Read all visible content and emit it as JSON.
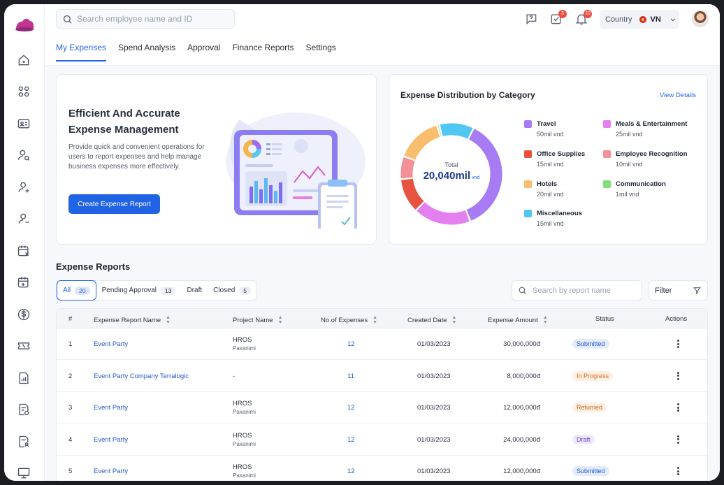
{
  "topbar": {
    "search_placeholder": "Search employee name and ID",
    "chat_badge": "",
    "tasks_badge": "3",
    "notifications_badge": "10",
    "country_label": "Country",
    "country_code": "VN"
  },
  "tabs": [
    {
      "label": "My Expenses",
      "active": true
    },
    {
      "label": "Spend Analysis",
      "active": false
    },
    {
      "label": "Approval",
      "active": false
    },
    {
      "label": "Finance Reports",
      "active": false
    },
    {
      "label": "Settings",
      "active": false
    }
  ],
  "promo": {
    "title": "Efficient And Accurate Expense Management",
    "description": "Provide quick and convenient operations for users to report expenses and help manage business expenses more effectively.",
    "button": "Create Expense Report"
  },
  "distribution": {
    "title": "Expense Distribution by Category",
    "view_details": "View Details",
    "total_label": "Total",
    "total_value": "20,040mil",
    "total_unit": "vnd",
    "categories": [
      {
        "name": "Travel",
        "value": "50mil vnd",
        "color": "#a77bf3"
      },
      {
        "name": "Meals & Entertainment",
        "value": "25mil vnd",
        "color": "#e47ff0"
      },
      {
        "name": "Office Supplies",
        "value": "15mil vnd",
        "color": "#e8533f"
      },
      {
        "name": "Employee Recognition",
        "value": "10mil vnd",
        "color": "#f38f96"
      },
      {
        "name": "Hotels",
        "value": "20mil vnd",
        "color": "#f8bd6d"
      },
      {
        "name": "Communication",
        "value": "1mil vnd",
        "color": "#7fe07b"
      },
      {
        "name": "Miscellaneous",
        "value": "15mil vnd",
        "color": "#4fc7f2"
      }
    ]
  },
  "reports": {
    "title": "Expense Reports",
    "filters": [
      {
        "label": "All",
        "count": "20",
        "active": true
      },
      {
        "label": "Pending Approval",
        "count": "13",
        "active": false
      },
      {
        "label": "Draft",
        "count": "",
        "active": false
      },
      {
        "label": "Closed",
        "count": "5",
        "active": false
      }
    ],
    "search_placeholder": "Search by report name",
    "filter_label": "Filter",
    "columns": [
      "#",
      "Expense Report Name",
      "Project Name",
      "No.of Expenses",
      "Created Date",
      "Expense Amount",
      "Status",
      "Actions"
    ],
    "rows": [
      {
        "no": "1",
        "name": "Event Party",
        "project": "HROS",
        "project_sub": "Paxanimi",
        "expenses": "12",
        "date": "01/03/2023",
        "amount": "30,000,000đ",
        "status": "Submitted"
      },
      {
        "no": "2",
        "name": "Event Party Company Terralogic",
        "project": "-",
        "project_sub": "",
        "expenses": "11",
        "date": "01/03/2023",
        "amount": "8,000,000đ",
        "status": "In Progress"
      },
      {
        "no": "3",
        "name": "Event Party",
        "project": "HROS",
        "project_sub": "Paxanimi",
        "expenses": "12",
        "date": "01/03/2023",
        "amount": "12,000,000đ",
        "status": "Returned"
      },
      {
        "no": "4",
        "name": "Event Party",
        "project": "HROS",
        "project_sub": "Paxanimi",
        "expenses": "12",
        "date": "01/03/2023",
        "amount": "24,000,000đ",
        "status": "Draft"
      },
      {
        "no": "5",
        "name": "Event Party",
        "project": "HROS",
        "project_sub": "Paxanimi",
        "expenses": "12",
        "date": "01/03/2023",
        "amount": "12,000,000đ",
        "status": "Submitted"
      }
    ]
  },
  "status_colors": {
    "Submitted": {
      "bg": "#e3ecfc",
      "fg": "#2258c7"
    },
    "In Progress": {
      "bg": "#fdf0e3",
      "fg": "#d86b1c"
    },
    "Returned": {
      "bg": "#fdf0e3",
      "fg": "#c4661f"
    },
    "Draft": {
      "bg": "#efe9fb",
      "fg": "#6c43c8"
    }
  },
  "icons": {
    "sidebar": [
      "home-icon",
      "apps-icon",
      "id-card-icon",
      "user-search-icon",
      "user-add-icon",
      "user-remove-icon",
      "calendar-x-icon",
      "calendar-add-icon",
      "dollar-icon",
      "ticket-icon",
      "report-chart-icon",
      "document-money-icon",
      "document-user-icon",
      "monitor-icon"
    ]
  }
}
